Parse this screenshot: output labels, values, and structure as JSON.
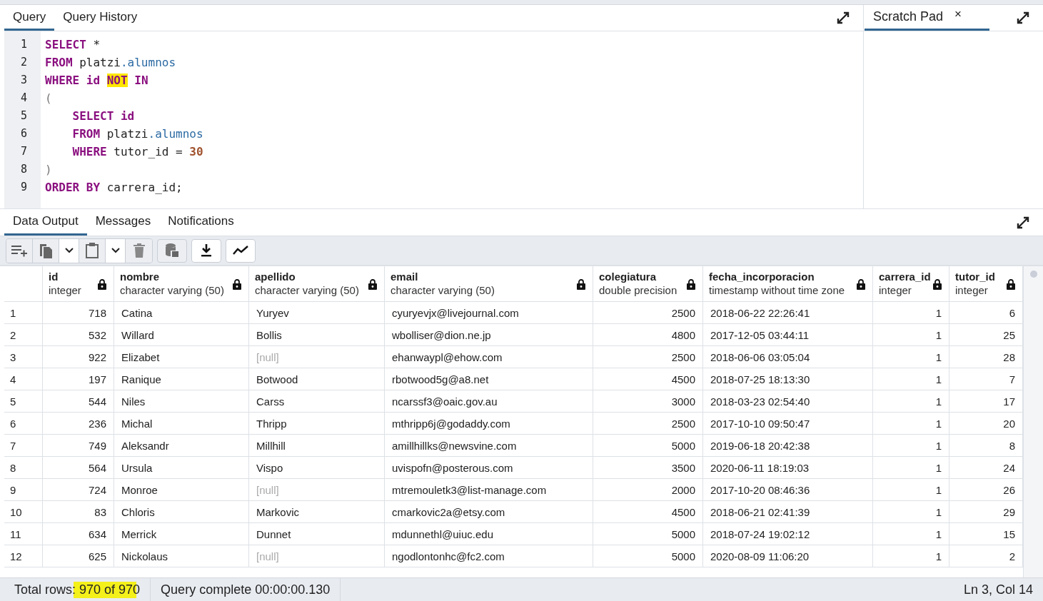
{
  "query_tabs": [
    {
      "label": "Query",
      "selected": true
    },
    {
      "label": "Query History",
      "selected": false
    }
  ],
  "editor": {
    "lines": [
      {
        "number": "1",
        "tokens": [
          {
            "text": "SELECT",
            "kind": "keyword"
          },
          {
            "text": " *",
            "kind": "plain"
          }
        ]
      },
      {
        "number": "2",
        "tokens": [
          {
            "text": "FROM",
            "kind": "keyword"
          },
          {
            "text": " platzi",
            "kind": "plain"
          },
          {
            "text": ".alumnos",
            "kind": "member"
          }
        ]
      },
      {
        "number": "3",
        "tokens": [
          {
            "text": "WHERE",
            "kind": "keyword"
          },
          {
            "text": " id ",
            "kind": "keyword"
          },
          {
            "text": "NOT",
            "kind": "keyword_marked"
          },
          {
            "text": " IN",
            "kind": "keyword"
          }
        ]
      },
      {
        "number": "4",
        "tokens": [
          {
            "text": "(",
            "kind": "punct"
          }
        ]
      },
      {
        "number": "5",
        "tokens": [
          {
            "text": "    SELECT id",
            "kind": "keyword"
          }
        ]
      },
      {
        "number": "6",
        "tokens": [
          {
            "text": "    FROM",
            "kind": "keyword"
          },
          {
            "text": " platzi",
            "kind": "plain"
          },
          {
            "text": ".alumnos",
            "kind": "member"
          }
        ]
      },
      {
        "number": "7",
        "tokens": [
          {
            "text": "    WHERE",
            "kind": "keyword"
          },
          {
            "text": " tutor_id = ",
            "kind": "plain"
          },
          {
            "text": "30",
            "kind": "number"
          }
        ]
      },
      {
        "number": "8",
        "tokens": [
          {
            "text": ")",
            "kind": "punct"
          }
        ]
      },
      {
        "number": "9",
        "tokens": [
          {
            "text": "ORDER BY",
            "kind": "keyword"
          },
          {
            "text": " carrera_id;",
            "kind": "plain"
          }
        ]
      }
    ]
  },
  "scratch_pad": {
    "tab": {
      "label": "Scratch Pad",
      "selected": true
    },
    "close": "×"
  },
  "result_tabs": [
    {
      "label": "Data Output",
      "selected": true
    },
    {
      "label": "Messages",
      "selected": false
    },
    {
      "label": "Notifications",
      "selected": false
    }
  ],
  "table": {
    "columns": [
      {
        "name": "id",
        "type": "integer",
        "kind": "numeric"
      },
      {
        "name": "nombre",
        "type": "character varying (50)",
        "kind": "text"
      },
      {
        "name": "apellido",
        "type": "character varying (50)",
        "kind": "text"
      },
      {
        "name": "email",
        "type": "character varying (50)",
        "kind": "text"
      },
      {
        "name": "colegiatura",
        "type": "double precision",
        "kind": "numeric"
      },
      {
        "name": "fecha_incorporacion",
        "type": "timestamp without time zone",
        "kind": "text"
      },
      {
        "name": "carrera_id",
        "type": "integer",
        "kind": "numeric"
      },
      {
        "name": "tutor_id",
        "type": "integer",
        "kind": "numeric"
      }
    ],
    "rows": [
      {
        "number": "1",
        "cells": [
          "718",
          "Catina",
          "Yuryev",
          "cyuryevjx@livejournal.com",
          "2500",
          "2018-06-22 22:26:41",
          "1",
          "6"
        ],
        "apellido_null": false
      },
      {
        "number": "2",
        "cells": [
          "532",
          "Willard",
          "Bollis",
          "wbolliser@dion.ne.jp",
          "4800",
          "2017-12-05 03:44:11",
          "1",
          "25"
        ],
        "apellido_null": false
      },
      {
        "number": "3",
        "cells": [
          "922",
          "Elizabet",
          "[null]",
          "ehanwaypl@ehow.com",
          "2500",
          "2018-06-06 03:05:04",
          "1",
          "28"
        ],
        "apellido_null": true
      },
      {
        "number": "4",
        "cells": [
          "197",
          "Ranique",
          "Botwood",
          "rbotwood5g@a8.net",
          "4500",
          "2018-07-25 18:13:30",
          "1",
          "7"
        ],
        "apellido_null": false
      },
      {
        "number": "5",
        "cells": [
          "544",
          "Niles",
          "Carss",
          "ncarssf3@oaic.gov.au",
          "3000",
          "2018-03-23 02:54:40",
          "1",
          "17"
        ],
        "apellido_null": false
      },
      {
        "number": "6",
        "cells": [
          "236",
          "Michal",
          "Thripp",
          "mthripp6j@godaddy.com",
          "2500",
          "2017-10-10 09:50:47",
          "1",
          "20"
        ],
        "apellido_null": false
      },
      {
        "number": "7",
        "cells": [
          "749",
          "Aleksandr",
          "Millhill",
          "amillhillks@newsvine.com",
          "5000",
          "2019-06-18 20:42:38",
          "1",
          "8"
        ],
        "apellido_null": false
      },
      {
        "number": "8",
        "cells": [
          "564",
          "Ursula",
          "Vispo",
          "uvispofn@posterous.com",
          "3500",
          "2020-06-11 18:19:03",
          "1",
          "24"
        ],
        "apellido_null": false
      },
      {
        "number": "9",
        "cells": [
          "724",
          "Monroe",
          "[null]",
          "mtremouletk3@list-manage.com",
          "2000",
          "2017-10-20 08:46:36",
          "1",
          "26"
        ],
        "apellido_null": true
      },
      {
        "number": "10",
        "cells": [
          "83",
          "Chloris",
          "Markovic",
          "cmarkovic2a@etsy.com",
          "4500",
          "2018-06-21 02:41:39",
          "1",
          "29"
        ],
        "apellido_null": false
      },
      {
        "number": "11",
        "cells": [
          "634",
          "Merrick",
          "Dunnet",
          "mdunnethl@uiuc.edu",
          "5000",
          "2018-07-24 19:02:12",
          "1",
          "15"
        ],
        "apellido_null": false
      },
      {
        "number": "12",
        "cells": [
          "625",
          "Nickolaus",
          "[null]",
          "ngodlontonhc@fc2.com",
          "5000",
          "2020-08-09 11:06:20",
          "1",
          "2"
        ],
        "apellido_null": true
      }
    ]
  },
  "status_bar": {
    "rows": "Total rows: 970 of 970",
    "query": "Query complete 00:00:00.130",
    "cursor": "Ln 3, Col 14"
  }
}
